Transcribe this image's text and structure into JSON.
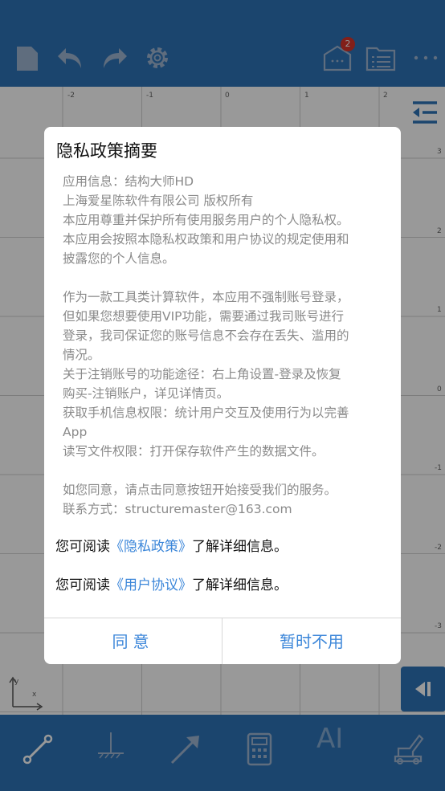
{
  "toolbar": {
    "badge_count": "2"
  },
  "grid": {
    "x_ticks": [
      "-2",
      "-1",
      "0",
      "1",
      "2"
    ],
    "y_ticks": [
      "3",
      "2",
      "1",
      "0",
      "-1",
      "-2",
      "-3"
    ],
    "axis_x": "x",
    "axis_y": "y"
  },
  "bottombar": {
    "ai_label": "AI"
  },
  "dialog": {
    "title": "隐私政策摘要",
    "body_lines": [
      "应用信息：结构大师HD",
      "上海爱星陈软件有限公司 版权所有",
      "本应用尊重并保护所有使用服务用户的个人隐私权。",
      "本应用会按照本隐私权政策和用户协议的规定使用和",
      "披露您的个人信息。",
      "",
      "作为一款工具类计算软件，本应用不强制账号登录，",
      "但如果您想要使用VIP功能，需要通过我司账号进行",
      "登录，我司保证您的账号信息不会存在丢失、滥用的",
      "情况。",
      "关于注销账号的功能途径：右上角设置-登录及恢复",
      "购买-注销账户，详见详情页。",
      "获取手机信息权限：统计用户交互及使用行为以完善",
      "App",
      "读写文件权限：打开保存软件产生的数据文件。",
      "",
      "如您同意，请点击同意按钮开始接受我们的服务。",
      "联系方式：structuremaster@163.com"
    ],
    "privacy_prefix": "您可阅读",
    "privacy_link": "《隐私政策》",
    "privacy_suffix": "了解详细信息。",
    "terms_prefix": "您可阅读",
    "terms_link": "《用户协议》",
    "terms_suffix": "了解详细信息。",
    "agree_label": "同意",
    "later_label": "暂时不用"
  },
  "colors": {
    "toolbar": "#2e73b8",
    "link": "#3b86d9",
    "badge": "#d9342b"
  }
}
